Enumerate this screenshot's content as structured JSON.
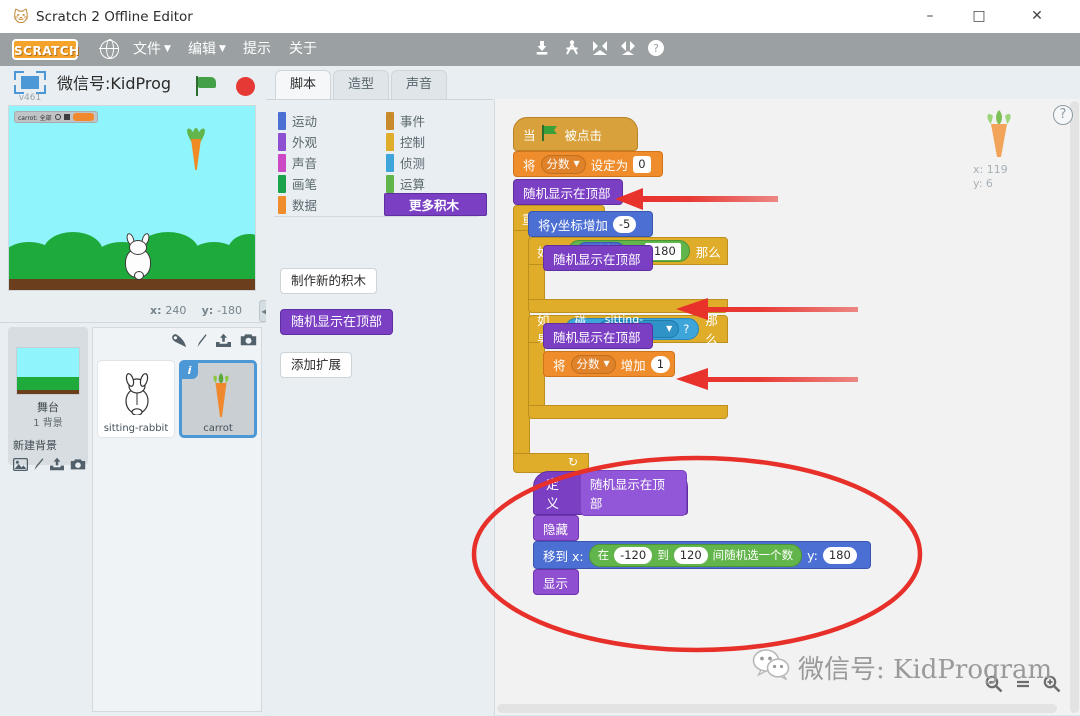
{
  "window": {
    "title": "Scratch 2 Offline Editor",
    "app_icon": "scratch-cat-icon",
    "minimize": "–",
    "maximize": "□",
    "close": "✕"
  },
  "menubar": {
    "logo": "SCRATCH",
    "globe_icon": "globe-icon",
    "items": [
      {
        "label": "文件",
        "has_caret": true
      },
      {
        "label": "编辑",
        "has_caret": true
      },
      {
        "label": "提示",
        "has_caret": false
      },
      {
        "label": "关于",
        "has_caret": false
      }
    ],
    "tools": [
      {
        "name": "stamp-icon",
        "glyph": "⬇"
      },
      {
        "name": "scissors-icon",
        "glyph": "✂"
      },
      {
        "name": "grow-icon",
        "glyph": "⤢"
      },
      {
        "name": "shrink-icon",
        "glyph": "⤡"
      },
      {
        "name": "help-icon",
        "glyph": "?"
      }
    ]
  },
  "stage": {
    "version_label": "v461",
    "project_title": "微信号:KidProg",
    "green_flag": "green-flag-icon",
    "stop_button": "stop-icon",
    "watcher": {
      "label": "carrot: 全部",
      "value": ""
    },
    "coords_x_label": "x:",
    "coords_x_value": "240",
    "coords_y_label": "y:",
    "coords_y_value": "-180",
    "collapse_arrow": "◀"
  },
  "sprite_pane": {
    "stage_label": "舞台",
    "stage_sublabel": "1 背景",
    "new_backdrop_label": "新建背景",
    "new_backdrop_icons": [
      {
        "name": "pick-backdrop-icon",
        "glyph": "🖼"
      },
      {
        "name": "paint-backdrop-icon",
        "glyph": "╱"
      },
      {
        "name": "upload-backdrop-icon",
        "glyph": "⤒"
      },
      {
        "name": "camera-backdrop-icon",
        "glyph": "◉"
      }
    ],
    "new_sprite_icons": [
      {
        "name": "pick-sprite-icon",
        "glyph": "♦"
      },
      {
        "name": "paint-sprite-icon",
        "glyph": "╱"
      },
      {
        "name": "upload-sprite-icon",
        "glyph": "⤒"
      },
      {
        "name": "camera-sprite-icon",
        "glyph": "◉"
      }
    ],
    "sprites": [
      {
        "name": "sitting-rabbit",
        "selected": false,
        "info_badge": "i"
      },
      {
        "name": "carrot",
        "selected": true,
        "info_badge": "i"
      }
    ]
  },
  "editor": {
    "tabs": [
      {
        "label": "脚本",
        "active": true
      },
      {
        "label": "造型",
        "active": false
      },
      {
        "label": "声音",
        "active": false
      }
    ],
    "palette": {
      "categories_left": [
        {
          "label": "运动",
          "color": "#4c6fd4"
        },
        {
          "label": "外观",
          "color": "#8e4fd0"
        },
        {
          "label": "声音",
          "color": "#cc49c4"
        },
        {
          "label": "画笔",
          "color": "#1aa34a"
        },
        {
          "label": "数据",
          "color": "#ef8c2b"
        }
      ],
      "categories_right": [
        {
          "label": "事件",
          "color": "#c88a2a",
          "selected": false
        },
        {
          "label": "控制",
          "color": "#e0ad2b",
          "selected": false
        },
        {
          "label": "侦测",
          "color": "#3da5d9",
          "selected": false
        },
        {
          "label": "运算",
          "color": "#62b54a",
          "selected": false
        },
        {
          "label": "更多积木",
          "color": "#7b3fc4",
          "selected": true
        }
      ],
      "make_block_button": "制作新的积木",
      "custom_block": "随机显示在顶部",
      "add_extension_button": "添加扩展"
    },
    "canvas": {
      "help_icon": "?",
      "sprite_watermark": {
        "icon": "carrot-icon",
        "x_label": "x:",
        "x_value": "119",
        "y_label": "y:",
        "y_value": "6"
      },
      "zoom_controls": [
        {
          "name": "zoom-out-icon",
          "glyph": "⊖"
        },
        {
          "name": "zoom-reset-icon",
          "glyph": "="
        },
        {
          "name": "zoom-in-icon",
          "glyph": "⊕"
        }
      ]
    },
    "scripts": {
      "main": {
        "hat": {
          "prefix": "当",
          "suffix": "被点击",
          "icon": "green-flag-icon"
        },
        "set_var": {
          "pre": "将",
          "variable": "分数",
          "mid": "设定为",
          "value": "0"
        },
        "call_top": "随机显示在顶部",
        "forever": "重复执行",
        "change_y": {
          "pre": "将y坐标增加",
          "value": "-5"
        },
        "if1": {
          "pre": "如果",
          "left": "y 坐标",
          "op": "=",
          "right": "-180",
          "post": "那么",
          "body": "随机显示在顶部"
        },
        "if2": {
          "pre": "如果",
          "sensing": "碰到",
          "target": "sitting-rabbit",
          "question": "?",
          "post": "那么",
          "body1": "随机显示在顶部",
          "body2": {
            "pre": "将",
            "variable": "分数",
            "mid": "增加",
            "value": "1"
          }
        },
        "loop_arrow": "↻"
      },
      "definition": {
        "define_label": "定义",
        "define_name": "随机显示在顶部",
        "hide": "隐藏",
        "goto": {
          "pre": "移到 x:",
          "rand_pre": "在",
          "rand_from": "-120",
          "rand_mid": "到",
          "rand_to": "120",
          "rand_post": "间随机选一个数",
          "y_label": "y:",
          "y_value": "180"
        },
        "show": "显示"
      }
    }
  },
  "annotations": {
    "arrow_color": "#e8302a",
    "ellipse_color": "#e8302a",
    "arrows": 3,
    "ellipse": 1
  },
  "watermark": {
    "icon": "wechat-icon",
    "text": "微信号: KidProgram"
  }
}
